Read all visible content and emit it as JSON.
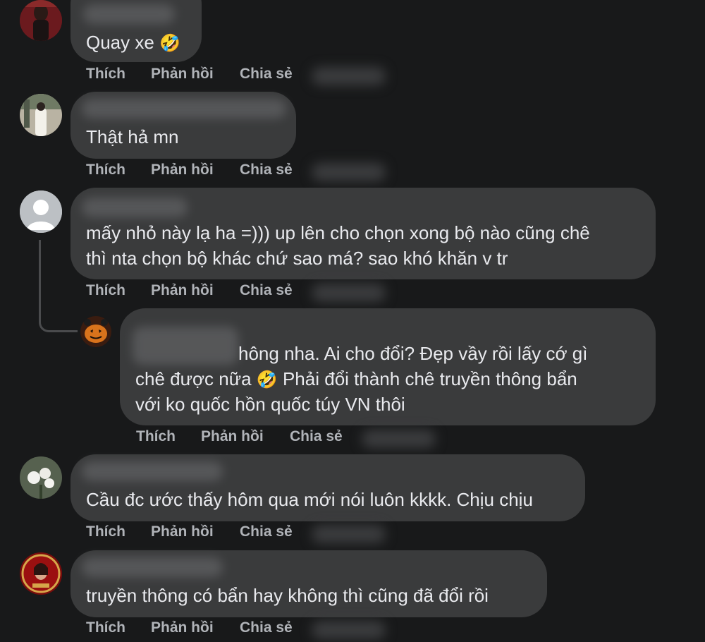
{
  "actions": {
    "like": "Thích",
    "reply": "Phản hồi",
    "share": "Chia sẻ"
  },
  "comments": [
    {
      "text": "Quay xe",
      "emoji": "🤣",
      "avatar": "user-photo-woman"
    },
    {
      "text": "Thật hả mn",
      "avatar": "user-photo-graduation"
    },
    {
      "lines": [
        "mấy nhỏ này lạ ha =))) up lên cho chọn xong bộ nào cũng chê",
        "thì nta chọn bộ khác chứ sao má? sao khó khăn v tr"
      ],
      "avatar": "default-avatar"
    },
    {
      "lines": [
        "hông nha. Ai cho đổi? Đẹp vầy rồi lấy cớ gì",
        "chê được nữa",
        "Phải đổi thành chê truyền thông bẩn",
        "với ko quốc hồn quốc túy VN thôi"
      ],
      "emoji": "🤣",
      "avatar": "pumpkin-avatar"
    },
    {
      "text": "Cầu đc ước thấy hôm qua mới nói luôn kkkk. Chịu chịu",
      "avatar": "flowers-avatar"
    },
    {
      "text": "truyền thông có bẩn hay không thì cũng đã đổi rồi",
      "avatar": "pageant-avatar"
    }
  ],
  "colors": {
    "background": "#18191a",
    "bubble": "#3a3b3c",
    "text": "#e9eaee",
    "action_text": "#b0b3b8"
  }
}
